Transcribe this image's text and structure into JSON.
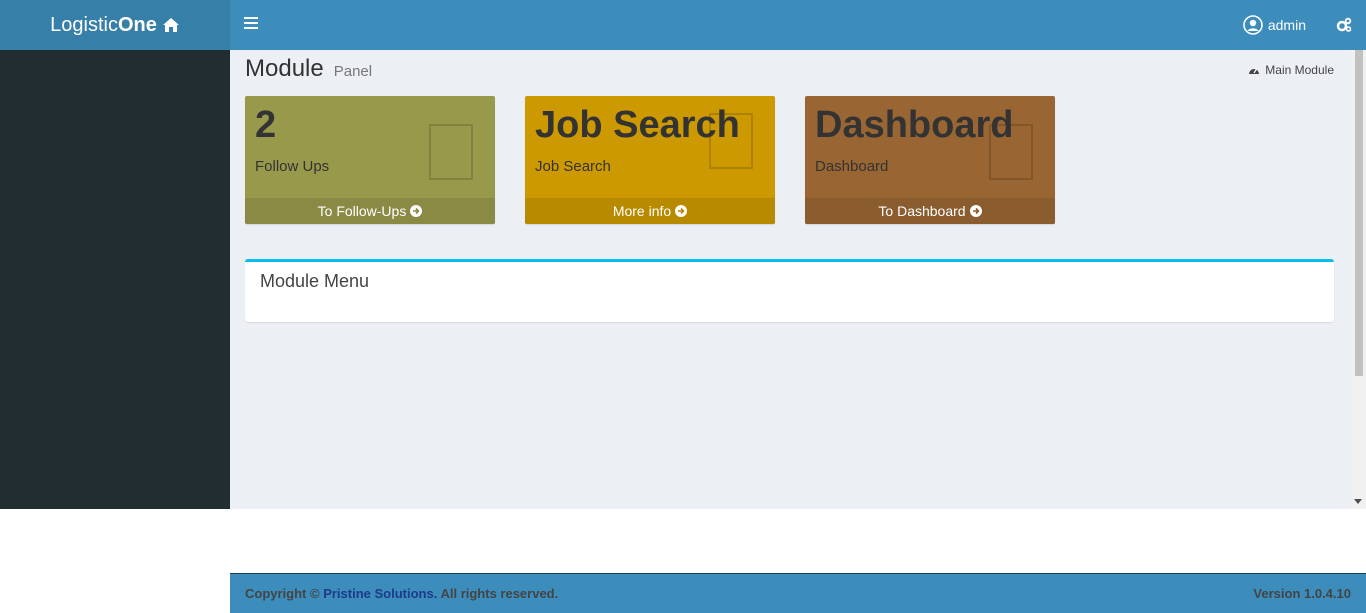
{
  "header": {
    "logo_light": "Logistic",
    "logo_bold": "One",
    "user_name": "admin"
  },
  "page": {
    "title": "Module",
    "subtitle": "Panel",
    "breadcrumb": "Main Module"
  },
  "boxes": [
    {
      "value": "2",
      "label": "Follow Ups",
      "footer": "To Follow-Ups",
      "color": "#99994c"
    },
    {
      "value": "Job Search",
      "label": "Job Search",
      "footer": "More info",
      "color": "#cc9900"
    },
    {
      "value": "Dashboard",
      "label": "Dashboard",
      "footer": "To Dashboard",
      "color": "#996633"
    }
  ],
  "module_menu": {
    "title": "Module Menu"
  },
  "footer": {
    "copyright_prefix": "Copyright ©",
    "company": "Pristine Solutions.",
    "rights": "All rights reserved.",
    "version": "Version 1.0.4.10"
  },
  "colors": {
    "header": "#3c8dbc",
    "logo_bg": "#367fa9",
    "sidebar": "#222d32",
    "content_bg": "#ecf0f5",
    "accent": "#00c0ef"
  }
}
